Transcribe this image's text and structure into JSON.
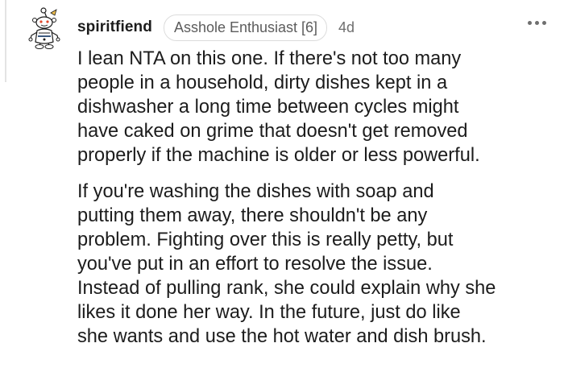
{
  "comment": {
    "author": "spiritfiend",
    "flair": "Asshole Enthusiast [6]",
    "age": "4d",
    "paragraphs": [
      [
        "I lean NTA on this one. If there's not too many",
        "people in a household, dirty dishes kept in a",
        "dishwasher a long time between cycles might",
        "have caked on grime that doesn't get removed",
        "properly if the machine is older or less powerful."
      ],
      [
        "If you're washing the dishes with soap and",
        "putting them away, there shouldn't be any",
        "problem. Fighting over this is really petty, but",
        "you've put in an effort to resolve the issue.",
        "Instead of pulling rank, she could explain why she",
        "likes it done her way. In the future, just do like",
        "she wants and use the hot water and dish brush."
      ]
    ]
  },
  "icons": {
    "avatar": "snoo-avatar-icon",
    "more": "more-options-icon"
  }
}
